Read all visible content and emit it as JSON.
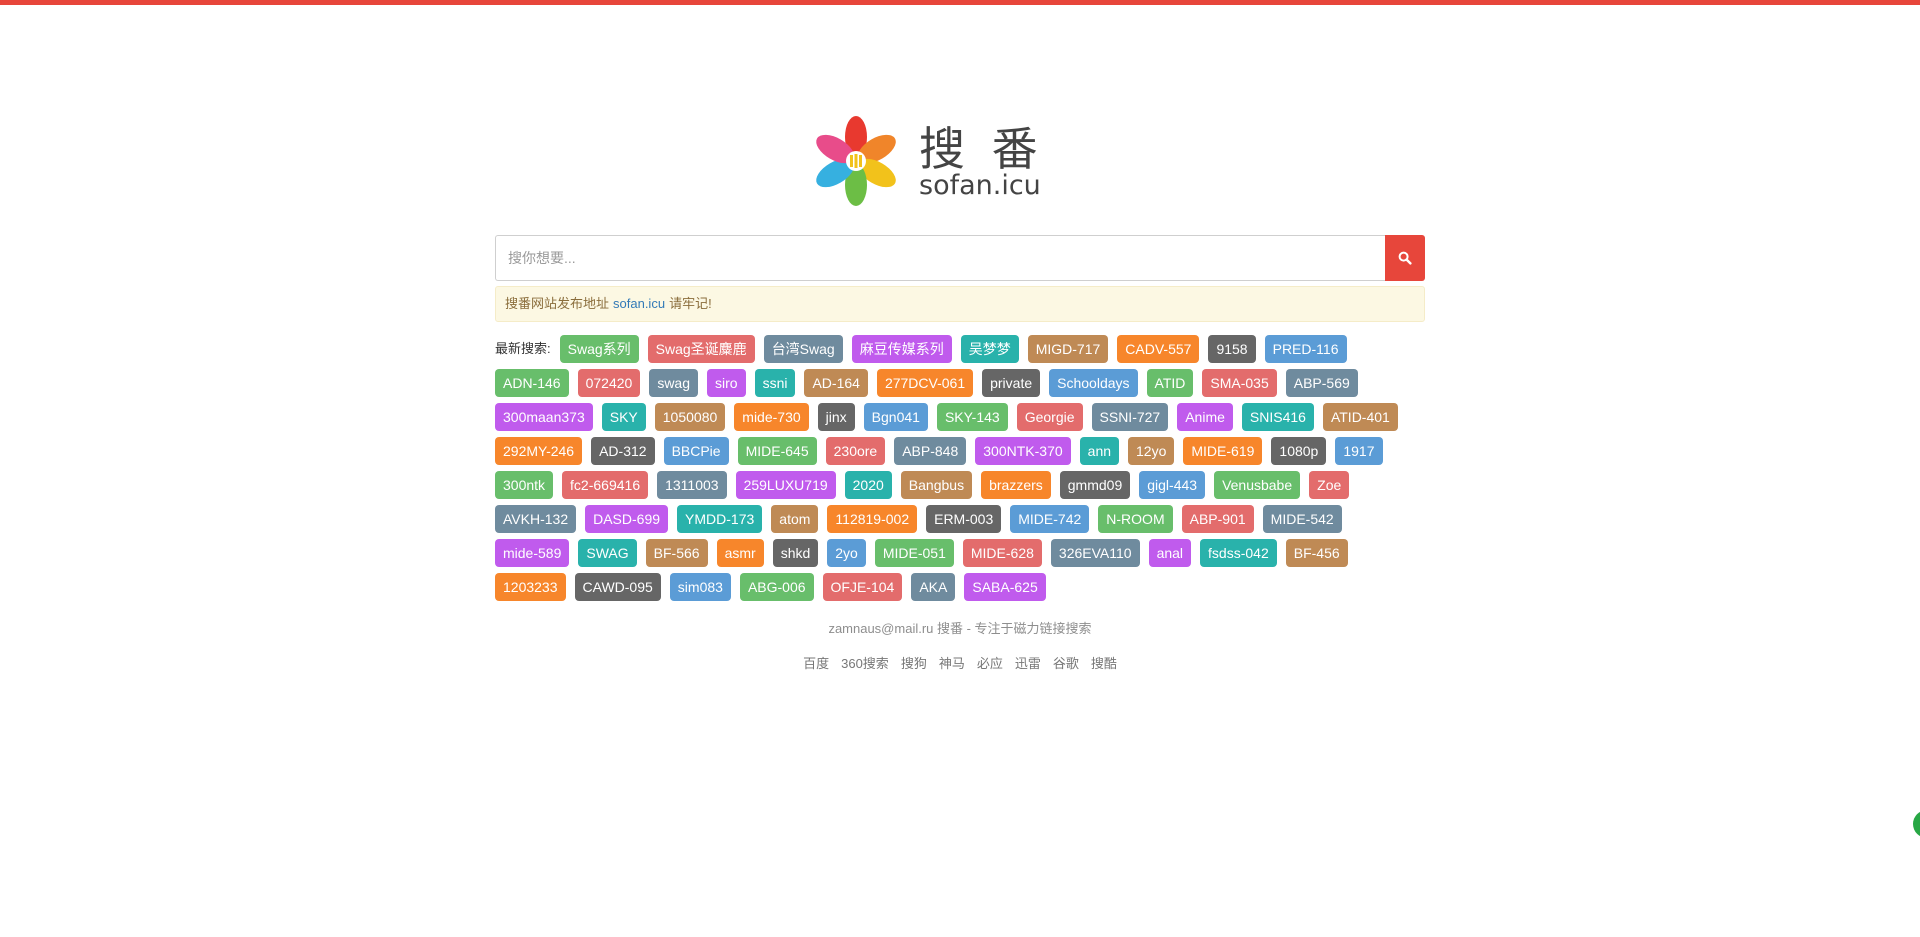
{
  "brand": {
    "title_cn": "搜 番",
    "domain": "sofan.icu"
  },
  "search": {
    "placeholder": "搜你想要...",
    "button_icon": "search-icon",
    "button_color": "#e7463b"
  },
  "notice": {
    "prefix": "搜番网站发布地址",
    "link": "sofan.icu",
    "suffix": "请牢记!"
  },
  "latest": {
    "label": "最新搜索:",
    "tags": [
      {
        "text": "Swag系列",
        "color": "#68be6b"
      },
      {
        "text": "Swag圣诞麋鹿",
        "color": "#e36c6c"
      },
      {
        "text": "台湾Swag",
        "color": "#6f8b9e"
      },
      {
        "text": "麻豆传媒系列",
        "color": "#c05bed"
      },
      {
        "text": "吴梦梦",
        "color": "#29b2ab"
      },
      {
        "text": "MIGD-717",
        "color": "#bf8a55"
      },
      {
        "text": "CADV-557",
        "color": "#f7862b"
      },
      {
        "text": "9158",
        "color": "#666666"
      },
      {
        "text": "PRED-116",
        "color": "#5b9cd6"
      },
      {
        "text": "ADN-146",
        "color": "#68be6b"
      },
      {
        "text": "072420",
        "color": "#e36c6c"
      },
      {
        "text": "swag",
        "color": "#6f8b9e"
      },
      {
        "text": "siro",
        "color": "#c05bed"
      },
      {
        "text": "ssni",
        "color": "#29b2ab"
      },
      {
        "text": "AD-164",
        "color": "#bf8a55"
      },
      {
        "text": "277DCV-061",
        "color": "#f7862b"
      },
      {
        "text": "private",
        "color": "#666666"
      },
      {
        "text": "Schooldays",
        "color": "#5b9cd6"
      },
      {
        "text": "ATID",
        "color": "#68be6b"
      },
      {
        "text": "SMA-035",
        "color": "#e36c6c"
      },
      {
        "text": "ABP-569",
        "color": "#6f8b9e"
      },
      {
        "text": "300maan373",
        "color": "#c05bed"
      },
      {
        "text": "SKY",
        "color": "#29b2ab"
      },
      {
        "text": "1050080",
        "color": "#bf8a55"
      },
      {
        "text": "mide-730",
        "color": "#f7862b"
      },
      {
        "text": "jinx",
        "color": "#666666"
      },
      {
        "text": "Bgn041",
        "color": "#5b9cd6"
      },
      {
        "text": "SKY-143",
        "color": "#68be6b"
      },
      {
        "text": "Georgie",
        "color": "#e36c6c"
      },
      {
        "text": "SSNI-727",
        "color": "#6f8b9e"
      },
      {
        "text": "Anime",
        "color": "#c05bed"
      },
      {
        "text": "SNIS416",
        "color": "#29b2ab"
      },
      {
        "text": "ATID-401",
        "color": "#bf8a55"
      },
      {
        "text": "292MY-246",
        "color": "#f7862b"
      },
      {
        "text": "AD-312",
        "color": "#666666"
      },
      {
        "text": "BBCPie",
        "color": "#5b9cd6"
      },
      {
        "text": "MIDE-645",
        "color": "#68be6b"
      },
      {
        "text": "230ore",
        "color": "#e36c6c"
      },
      {
        "text": "ABP-848",
        "color": "#6f8b9e"
      },
      {
        "text": "300NTK-370",
        "color": "#c05bed"
      },
      {
        "text": "ann",
        "color": "#29b2ab"
      },
      {
        "text": "12yo",
        "color": "#bf8a55"
      },
      {
        "text": "MIDE-619",
        "color": "#f7862b"
      },
      {
        "text": "1080p",
        "color": "#666666"
      },
      {
        "text": "1917",
        "color": "#5b9cd6"
      },
      {
        "text": "300ntk",
        "color": "#68be6b"
      },
      {
        "text": "fc2-669416",
        "color": "#e36c6c"
      },
      {
        "text": "1311003",
        "color": "#6f8b9e"
      },
      {
        "text": "259LUXU719",
        "color": "#c05bed"
      },
      {
        "text": "2020",
        "color": "#29b2ab"
      },
      {
        "text": "Bangbus",
        "color": "#bf8a55"
      },
      {
        "text": "brazzers",
        "color": "#f7862b"
      },
      {
        "text": "gmmd09",
        "color": "#666666"
      },
      {
        "text": "gigl-443",
        "color": "#5b9cd6"
      },
      {
        "text": "Venusbabe",
        "color": "#68be6b"
      },
      {
        "text": "Zoe",
        "color": "#e36c6c"
      },
      {
        "text": "AVKH-132",
        "color": "#6f8b9e"
      },
      {
        "text": "DASD-699",
        "color": "#c05bed"
      },
      {
        "text": "YMDD-173",
        "color": "#29b2ab"
      },
      {
        "text": "atom",
        "color": "#bf8a55"
      },
      {
        "text": "112819-002",
        "color": "#f7862b"
      },
      {
        "text": "ERM-003",
        "color": "#666666"
      },
      {
        "text": "MIDE-742",
        "color": "#5b9cd6"
      },
      {
        "text": "N-ROOM",
        "color": "#68be6b"
      },
      {
        "text": "ABP-901",
        "color": "#e36c6c"
      },
      {
        "text": "MIDE-542",
        "color": "#6f8b9e"
      },
      {
        "text": "mide-589",
        "color": "#c05bed"
      },
      {
        "text": "SWAG",
        "color": "#29b2ab"
      },
      {
        "text": "BF-566",
        "color": "#bf8a55"
      },
      {
        "text": "asmr",
        "color": "#f7862b"
      },
      {
        "text": "shkd",
        "color": "#666666"
      },
      {
        "text": "2yo",
        "color": "#5b9cd6"
      },
      {
        "text": "MIDE-051",
        "color": "#68be6b"
      },
      {
        "text": "MIDE-628",
        "color": "#e36c6c"
      },
      {
        "text": "326EVA110",
        "color": "#6f8b9e"
      },
      {
        "text": "anal",
        "color": "#c05bed"
      },
      {
        "text": "fsdss-042",
        "color": "#29b2ab"
      },
      {
        "text": "BF-456",
        "color": "#bf8a55"
      },
      {
        "text": "1203233",
        "color": "#f7862b"
      },
      {
        "text": "CAWD-095",
        "color": "#666666"
      },
      {
        "text": "sim083",
        "color": "#5b9cd6"
      },
      {
        "text": "ABG-006",
        "color": "#68be6b"
      },
      {
        "text": "OFJE-104",
        "color": "#e36c6c"
      },
      {
        "text": "AKA",
        "color": "#6f8b9e"
      },
      {
        "text": "SABA-625",
        "color": "#c05bed"
      }
    ]
  },
  "footer": {
    "email_line": "zamnaus@mail.ru 搜番 - 专注于磁力链接搜索",
    "links": [
      "百度",
      "360搜索",
      "搜狗",
      "神马",
      "必应",
      "迅雷",
      "谷歌",
      "搜酷"
    ]
  },
  "colors": {
    "accent": "#e7463b",
    "notice_bg": "#fcf8e3",
    "side_widget": "#28a745"
  }
}
